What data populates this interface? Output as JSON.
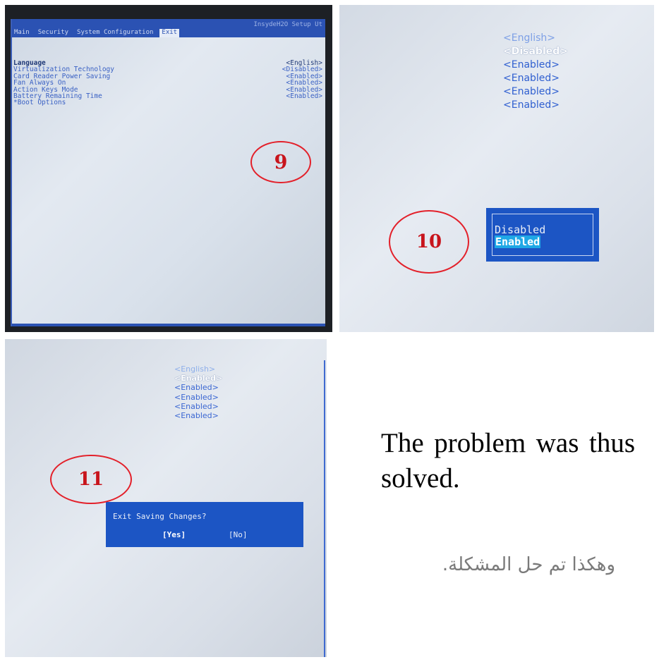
{
  "photo9": {
    "vendor": "InsydeH2O Setup Ut",
    "tabs": [
      {
        "label": "Main",
        "active": false
      },
      {
        "label": "Security",
        "active": false
      },
      {
        "label": "System Configuration",
        "active": false
      },
      {
        "label": "Exit",
        "active": true
      }
    ],
    "rows": [
      {
        "label": "Language",
        "value": "<English>"
      },
      {
        "label": "Virtualization Technology",
        "value": "<Disabled>"
      },
      {
        "label": "Card Reader Power Saving",
        "value": "<Enabled>"
      },
      {
        "label": "Fan Always On",
        "value": "<Enabled>"
      },
      {
        "label": "Action Keys Mode",
        "value": "<Enabled>"
      },
      {
        "label": "Battery Remaining Time",
        "value": "<Enabled>"
      },
      {
        "label": "*Boot Options",
        "value": ""
      }
    ],
    "marker": "9"
  },
  "photo10": {
    "values": [
      "<English>",
      "<Disabled>",
      "<Enabled>",
      "<Enabled>",
      "<Enabled>",
      "<Enabled>"
    ],
    "popup": {
      "options": [
        "Disabled",
        "Enabled"
      ],
      "selected": "Enabled"
    },
    "marker": "10"
  },
  "photo11": {
    "values": [
      "<English>",
      "<Enabled>",
      "<Enabled>",
      "<Enabled>",
      "<Enabled>",
      "<Enabled>"
    ],
    "dialog": {
      "message": "Exit Saving Changes?",
      "yes": "[Yes]",
      "no": "[No]"
    },
    "marker": "11"
  },
  "caption": {
    "english": "The problem was thus solved.",
    "arabic": "وهكذا تم حل المشكلة."
  },
  "colors": {
    "bios_blue": "#1c55c4",
    "marker_red": "#e3202a"
  }
}
